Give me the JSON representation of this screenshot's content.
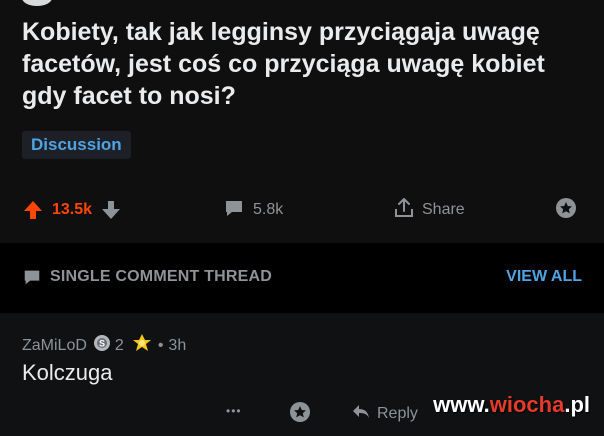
{
  "post": {
    "title": "Kobiety, tak jak legginsy przyciągaja uwagę facetów, jest coś co przyciąga uwagę kobiet gdy facet to nosi?",
    "flair": "Discussion",
    "score": "13.5k",
    "comments": "5.8k",
    "share_label": "Share"
  },
  "thread": {
    "label": "SINGLE COMMENT THREAD",
    "view_all": "VIEW ALL"
  },
  "comment": {
    "author": "ZaMiLoD",
    "award_count": "2",
    "separator": "•",
    "time": "3h",
    "body": "Kolczuga",
    "more": "•••",
    "reply_label": "Reply"
  },
  "watermark": {
    "part1": "www.",
    "part2": "wiocha",
    "part3": ".pl"
  },
  "colors": {
    "upvote": "#ff4500",
    "link": "#4fa3e3",
    "muted": "#8e9398",
    "background": "#0f0f10"
  },
  "icons": [
    "upvote-arrow",
    "downvote-arrow",
    "comment-bubble",
    "share-arrow",
    "award",
    "silver-award",
    "gold-award",
    "reply-arrow"
  ]
}
